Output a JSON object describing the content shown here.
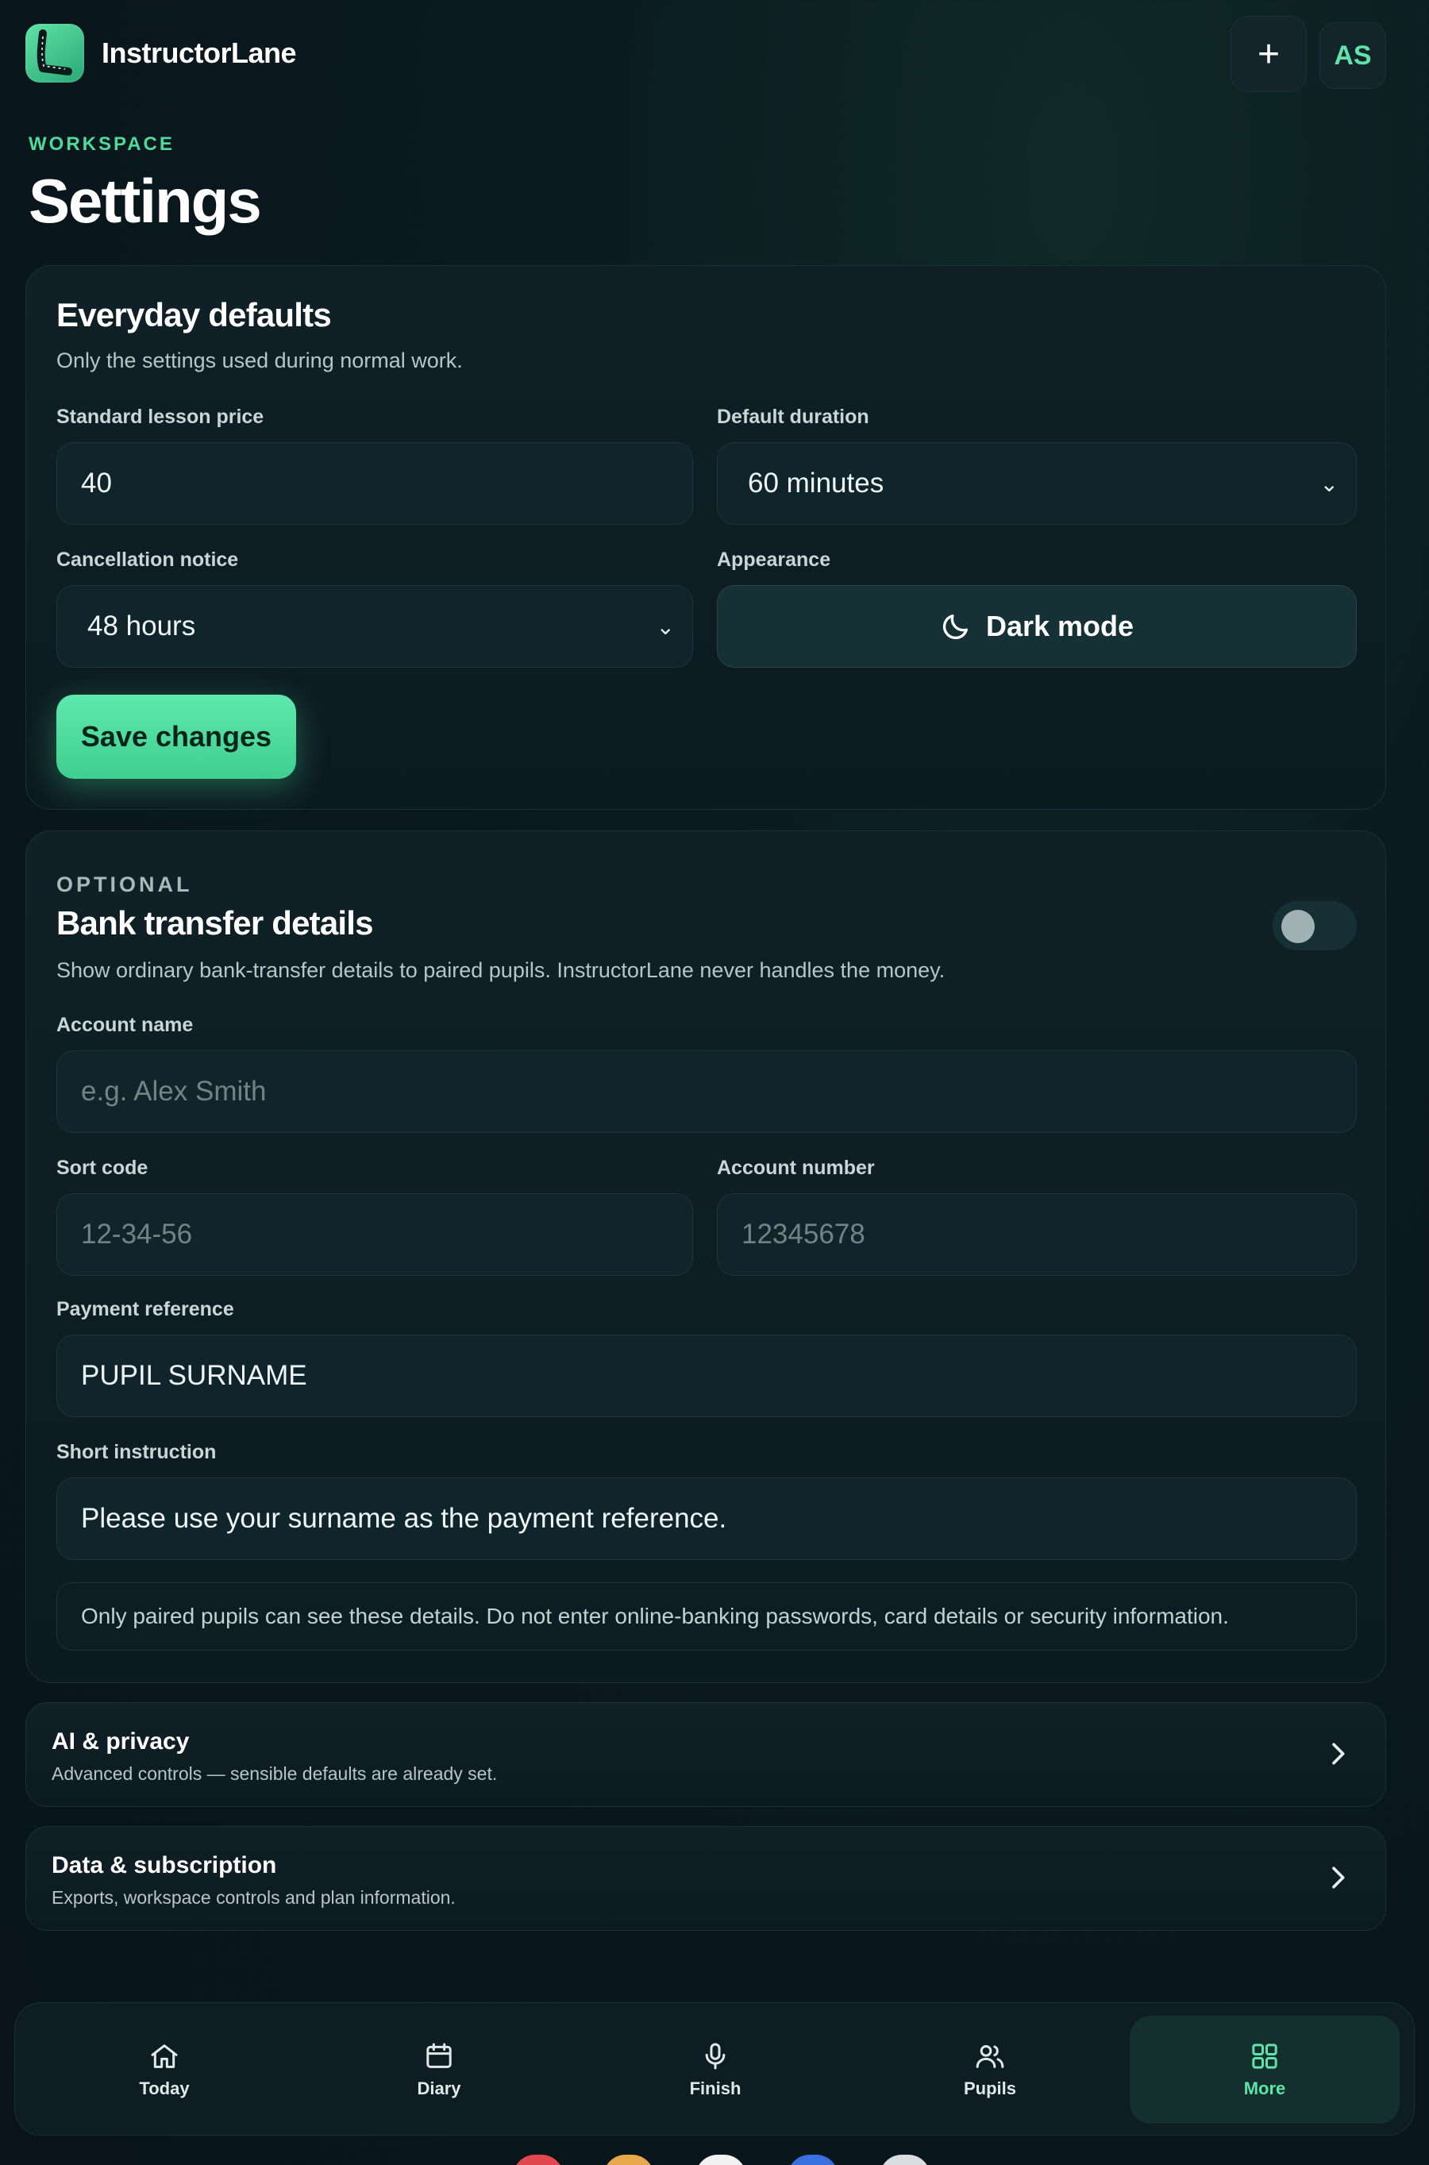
{
  "header": {
    "brand": "InstructorLane",
    "add_button_label": "+",
    "avatar_initials": "AS"
  },
  "page": {
    "eyebrow": "WORKSPACE",
    "title": "Settings"
  },
  "everyday": {
    "title": "Everyday defaults",
    "subtitle": "Only the settings used during normal work.",
    "price_label": "Standard lesson price",
    "price_value": "40",
    "duration_label": "Default duration",
    "duration_value": "60 minutes",
    "cancellation_label": "Cancellation notice",
    "cancellation_value": "48 hours",
    "appearance_label": "Appearance",
    "appearance_button": "Dark mode",
    "save_label": "Save changes"
  },
  "bank": {
    "eyebrow": "OPTIONAL",
    "title": "Bank transfer details",
    "subtitle": "Show ordinary bank-transfer details to paired pupils. InstructorLane never handles the money.",
    "toggle_on": false,
    "account_name_label": "Account name",
    "account_name_placeholder": "e.g. Alex Smith",
    "sort_code_label": "Sort code",
    "sort_code_placeholder": "12-34-56",
    "account_number_label": "Account number",
    "account_number_placeholder": "12345678",
    "reference_label": "Payment reference",
    "reference_value": "PUPIL SURNAME",
    "instruction_label": "Short instruction",
    "instruction_value": "Please use your surname as the payment reference.",
    "note": "Only paired pupils can see these details. Do not enter online-banking passwords, card details or security information."
  },
  "links": [
    {
      "title": "AI & privacy",
      "subtitle": "Advanced controls — sensible defaults are already set."
    },
    {
      "title": "Data & subscription",
      "subtitle": "Exports, workspace controls and plan information."
    }
  ],
  "nav": [
    {
      "label": "Today",
      "icon": "home-icon",
      "active": false
    },
    {
      "label": "Diary",
      "icon": "calendar-icon",
      "active": false
    },
    {
      "label": "Finish",
      "icon": "microphone-icon",
      "active": false
    },
    {
      "label": "Pupils",
      "icon": "users-icon",
      "active": false
    },
    {
      "label": "More",
      "icon": "grid-icon",
      "active": true
    }
  ],
  "colors": {
    "accent": "#4fd99b",
    "background": "#081419",
    "card": "#0f2026"
  }
}
